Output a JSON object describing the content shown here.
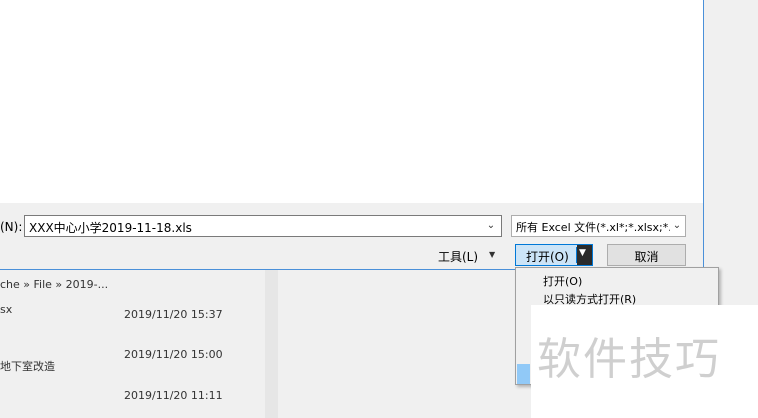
{
  "dialog": {
    "filename_label": "(N):",
    "filename_value": "XXX中心小学2019-11-18.xls",
    "file_type_filter": "所有 Excel 文件(*.xl*;*.xlsx;*.xl",
    "tools_label": "工具(L)",
    "open_button_label": "打开(O)",
    "cancel_button_label": "取消"
  },
  "open_menu": {
    "items": [
      {
        "label": "打开(O)"
      },
      {
        "label": "以只读方式打开(R)"
      }
    ]
  },
  "background_list": {
    "breadcrumb": "che » File » 2019-...",
    "rows": [
      {
        "name": "sx",
        "date": "2019/11/20 15:37"
      },
      {
        "name": "地下室改造",
        "date": "2019/11/20 15:00"
      },
      {
        "name": "",
        "date": "2019/11/20 11:11"
      }
    ]
  },
  "watermark": {
    "text": "软件技巧"
  },
  "icons": {
    "dropdown": "chevron-down-icon",
    "split_arrow": "triangle-down-icon"
  },
  "colors": {
    "accent": "#0078d7",
    "highlight": "#91c9f7"
  }
}
